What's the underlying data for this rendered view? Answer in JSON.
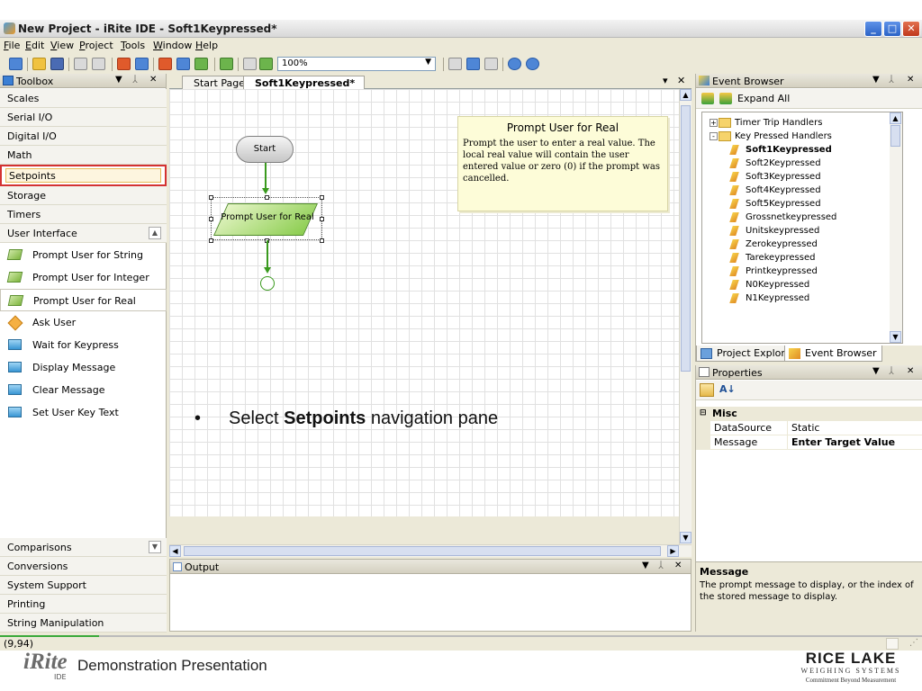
{
  "window": {
    "title": "New Project - iRite IDE - Soft1Keypressed*"
  },
  "menubar": [
    {
      "underline": "F",
      "rest": "ile"
    },
    {
      "underline": "E",
      "rest": "dit"
    },
    {
      "underline": "V",
      "rest": "iew"
    },
    {
      "underline": "P",
      "rest": "roject"
    },
    {
      "underline": "T",
      "rest": "ools"
    },
    {
      "underline": "W",
      "rest": "indow"
    },
    {
      "underline": "H",
      "rest": "elp"
    }
  ],
  "toolbar": {
    "zoom_value": "100%"
  },
  "toolbox": {
    "title": "Toolbox",
    "categories_top": [
      "Scales",
      "Serial I/O",
      "Digital I/O",
      "Math",
      "Setpoints",
      "Storage",
      "Timers",
      "User Interface"
    ],
    "selected_category": "Setpoints",
    "tools": [
      {
        "label": "Prompt User for String",
        "icon": "prompt-icon"
      },
      {
        "label": "Prompt User for Integer",
        "icon": "prompt-icon"
      },
      {
        "label": "Prompt User for Real",
        "icon": "prompt-icon"
      },
      {
        "label": "Ask User",
        "icon": "diamond-icon"
      },
      {
        "label": "Wait for Keypress",
        "icon": "process-icon"
      },
      {
        "label": "Display Message",
        "icon": "process-icon"
      },
      {
        "label": "Clear Message",
        "icon": "process-icon"
      },
      {
        "label": "Set User Key Text",
        "icon": "process-icon"
      }
    ],
    "categories_bottom": [
      "Comparisons",
      "Conversions",
      "System Support",
      "Printing",
      "String Manipulation"
    ]
  },
  "document_tabs": [
    {
      "label": "Start Page",
      "active": false
    },
    {
      "label": "Soft1Keypressed*",
      "active": true
    }
  ],
  "designer": {
    "start_node": "Start",
    "prompt_node": "Prompt User for Real",
    "tooltip": {
      "title": "Prompt User for Real",
      "body": "Prompt the user to enter a real value. The local real value will contain the user entered value or zero (0) if the prompt was cancelled."
    }
  },
  "output": {
    "title": "Output"
  },
  "event_browser": {
    "title": "Event Browser",
    "expand_all": "Expand All",
    "tree": [
      {
        "label": "Timer Trip Handlers",
        "level": 0,
        "type": "folder",
        "expander": "+"
      },
      {
        "label": "Key Pressed Handlers",
        "level": 0,
        "type": "folder",
        "expander": "-"
      },
      {
        "label": "Soft1Keypressed",
        "level": 1,
        "type": "handler",
        "bold": true
      },
      {
        "label": "Soft2Keypressed",
        "level": 1,
        "type": "handler"
      },
      {
        "label": "Soft3Keypressed",
        "level": 1,
        "type": "handler"
      },
      {
        "label": "Soft4Keypressed",
        "level": 1,
        "type": "handler"
      },
      {
        "label": "Soft5Keypressed",
        "level": 1,
        "type": "handler"
      },
      {
        "label": "Grossnetkeypressed",
        "level": 1,
        "type": "handler"
      },
      {
        "label": "Unitskeypressed",
        "level": 1,
        "type": "handler"
      },
      {
        "label": "Zerokeypressed",
        "level": 1,
        "type": "handler"
      },
      {
        "label": "Tarekeypressed",
        "level": 1,
        "type": "handler"
      },
      {
        "label": "Printkeypressed",
        "level": 1,
        "type": "handler"
      },
      {
        "label": "N0Keypressed",
        "level": 1,
        "type": "handler"
      },
      {
        "label": "N1Keypressed",
        "level": 1,
        "type": "handler"
      }
    ],
    "tabs": [
      {
        "label": "Project Explorer",
        "active": false
      },
      {
        "label": "Event Browser",
        "active": true
      }
    ]
  },
  "properties": {
    "title": "Properties",
    "category": "Misc",
    "rows": [
      {
        "name": "DataSource",
        "value": "Static",
        "bold": false
      },
      {
        "name": "Message",
        "value": "Enter Target Value",
        "bold": true
      }
    ],
    "description_title": "Message",
    "description_text": "The prompt message to display, or the index of the stored message to display."
  },
  "statusbar": {
    "text": "(9,94)"
  },
  "slide": {
    "bullet": "•",
    "annotation_before": "Select ",
    "annotation_bold": "Setpoints",
    "annotation_after": " navigation pane",
    "footer_logo": "iRite",
    "footer_logo_sub": "IDE",
    "footer_text": "Demonstration Presentation",
    "brand_line1": "RICE LAKE",
    "brand_line2": "WEIGHING SYSTEMS",
    "brand_line3": "Commitment Beyond Measurement"
  },
  "colors": {
    "highlight_box": "#d43232",
    "flow_green": "#3a9a1e",
    "tooltip_bg": "#fdfcd8"
  }
}
